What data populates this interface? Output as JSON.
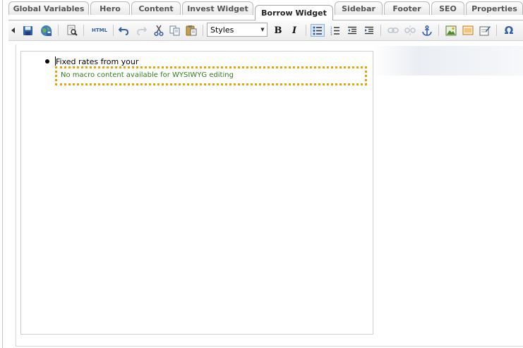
{
  "tabs": [
    {
      "label": "Global Variables"
    },
    {
      "label": "Hero"
    },
    {
      "label": "Content"
    },
    {
      "label": "Invest Widget"
    },
    {
      "label": "Borrow Widget",
      "active": true
    },
    {
      "label": "Sidebar"
    },
    {
      "label": "Footer"
    },
    {
      "label": "SEO"
    },
    {
      "label": "Properties"
    }
  ],
  "toolbar": {
    "html_label": "HTML",
    "styles_value": "Styles",
    "bold_label": "B",
    "italic_label": "I",
    "special_char_label": "Ω",
    "icons": [
      "collapse-arrow-icon",
      "save-icon",
      "save-publish-icon",
      "preview-icon",
      "html-source-icon",
      "undo-icon",
      "redo-icon",
      "cut-icon",
      "copy-icon",
      "paste-icon",
      "bullet-list-icon",
      "numbered-list-icon",
      "outdent-icon",
      "indent-icon",
      "link-icon",
      "unlink-icon",
      "anchor-icon",
      "image-icon",
      "media-icon",
      "form-icon",
      "special-character-icon"
    ]
  },
  "editor": {
    "list_item_text": "Fixed rates from your",
    "macro_placeholder": "No macro content available for WYSIWYG editing"
  },
  "colors": {
    "macro_border": "#f0a000",
    "macro_text": "#2e7d1a",
    "icon_blue": "#2f5fa8"
  }
}
